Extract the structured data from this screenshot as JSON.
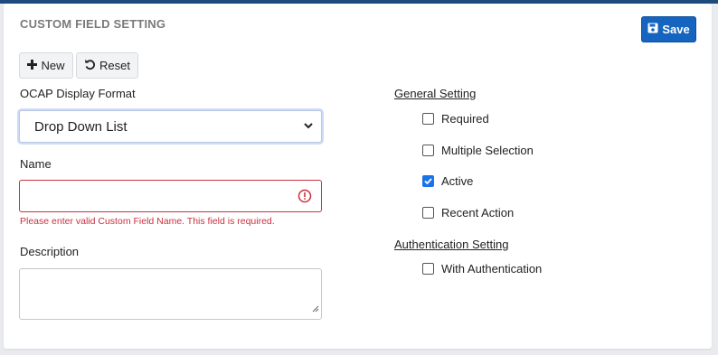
{
  "page": {
    "title": "CUSTOM FIELD SETTING"
  },
  "toolbar": {
    "save_label": "Save",
    "new_label": "New",
    "reset_label": "Reset"
  },
  "form": {
    "display_format": {
      "label": "OCAP Display Format",
      "selected": "Drop Down List"
    },
    "name": {
      "label": "Name",
      "value": "",
      "error": "Please enter valid Custom Field Name. This field is required."
    },
    "description": {
      "label": "Description",
      "value": ""
    }
  },
  "general_setting": {
    "title": "General Setting",
    "options": [
      {
        "label": "Required",
        "checked": false
      },
      {
        "label": "Multiple Selection",
        "checked": false
      },
      {
        "label": "Active",
        "checked": true
      },
      {
        "label": "Recent Action",
        "checked": false
      }
    ]
  },
  "authentication_setting": {
    "title": "Authentication Setting",
    "options": [
      {
        "label": "With Authentication",
        "checked": false
      }
    ]
  },
  "colors": {
    "primary": "#1565c0",
    "error": "#c9303e",
    "header_band": "#1f4a7e"
  }
}
